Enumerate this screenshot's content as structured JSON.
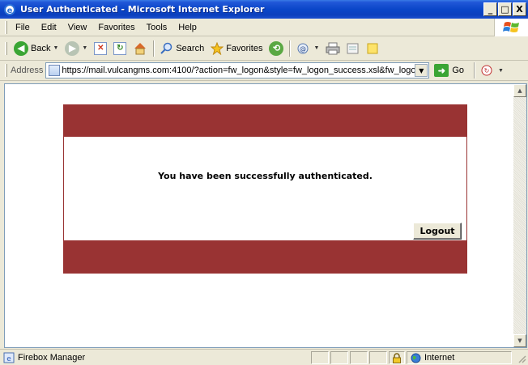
{
  "window": {
    "title": "User Authenticated - Microsoft Internet Explorer",
    "controls": [
      "_",
      "□",
      "X"
    ]
  },
  "menu": [
    "File",
    "Edit",
    "View",
    "Favorites",
    "Tools",
    "Help"
  ],
  "toolbar": {
    "back_label": "Back",
    "search_label": "Search",
    "favorites_label": "Favorites"
  },
  "address": {
    "label": "Address",
    "url": "https://mail.vulcangms.com:4100/?action=fw_logon&style=fw_logon_success.xsl&fw_logon_",
    "go_label": "Go"
  },
  "page": {
    "message": "You have been successfully authenticated.",
    "logout_label": "Logout",
    "banner_color": "#993333"
  },
  "status": {
    "text": "Firebox Manager",
    "zone": "Internet"
  }
}
